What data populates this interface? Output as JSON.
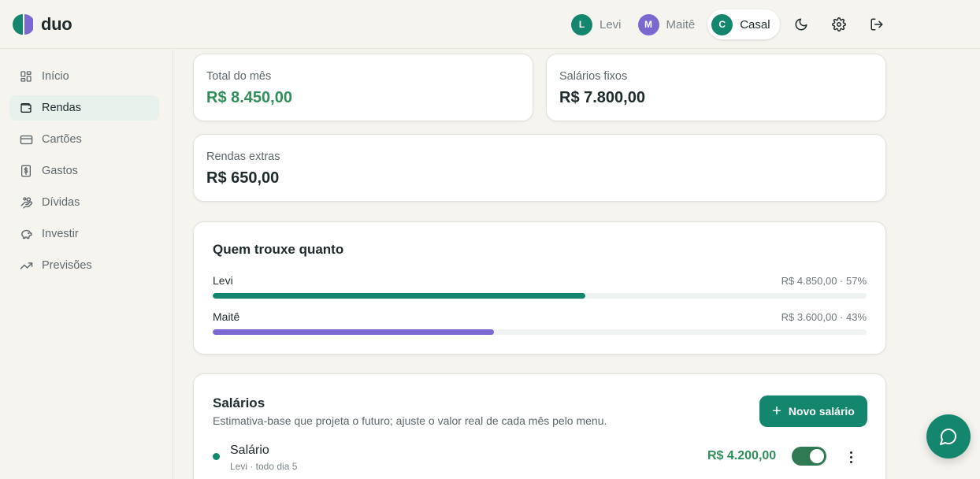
{
  "app": {
    "name": "duo"
  },
  "switcher": [
    {
      "initial": "L",
      "name": "Levi",
      "color": "#14866d",
      "active": false
    },
    {
      "initial": "M",
      "name": "Maitê",
      "color": "#7b68d0",
      "active": false
    },
    {
      "initial": "C",
      "name": "Casal",
      "color": "#14866d",
      "active": true
    }
  ],
  "header_icons": [
    "moon-icon",
    "gear-icon",
    "logout-icon"
  ],
  "sidebar": {
    "items": [
      {
        "label": "Início",
        "icon": "dashboard-icon",
        "active": false
      },
      {
        "label": "Rendas",
        "icon": "wallet-icon",
        "active": true
      },
      {
        "label": "Cartões",
        "icon": "credit-card-icon",
        "active": false
      },
      {
        "label": "Gastos",
        "icon": "receipt-icon",
        "active": false
      },
      {
        "label": "Dívidas",
        "icon": "hand-coins-icon",
        "active": false
      },
      {
        "label": "Investir",
        "icon": "piggy-bank-icon",
        "active": false
      },
      {
        "label": "Previsões",
        "icon": "trending-up-icon",
        "active": false
      }
    ]
  },
  "stats": {
    "total": {
      "label": "Total do mês",
      "value": "R$ 8.450,00"
    },
    "fixos": {
      "label": "Salários fixos",
      "value": "R$ 7.800,00"
    },
    "extras": {
      "label": "Rendas extras",
      "value": "R$ 650,00"
    }
  },
  "contributions": {
    "title": "Quem trouxe quanto",
    "people": [
      {
        "name": "Levi",
        "amount": "R$ 4.850,00 · 57%",
        "share": 0.57,
        "color": "#14866d"
      },
      {
        "name": "Maitê",
        "amount": "R$ 3.600,00 · 43%",
        "share": 0.43,
        "color": "#7b68d0"
      }
    ]
  },
  "salaries": {
    "title": "Salários",
    "subtitle": "Estimativa-base que projeta o futuro; ajuste o valor real de cada mês pelo menu.",
    "new_button": "Novo salário",
    "rows": [
      {
        "name": "Salário",
        "meta": "Levi · todo dia 5",
        "amount": "R$ 4.200,00",
        "enabled": true
      }
    ]
  },
  "colors": {
    "accent": "#14866d",
    "positive": "#2f8f5b",
    "maite": "#7b68d0"
  }
}
